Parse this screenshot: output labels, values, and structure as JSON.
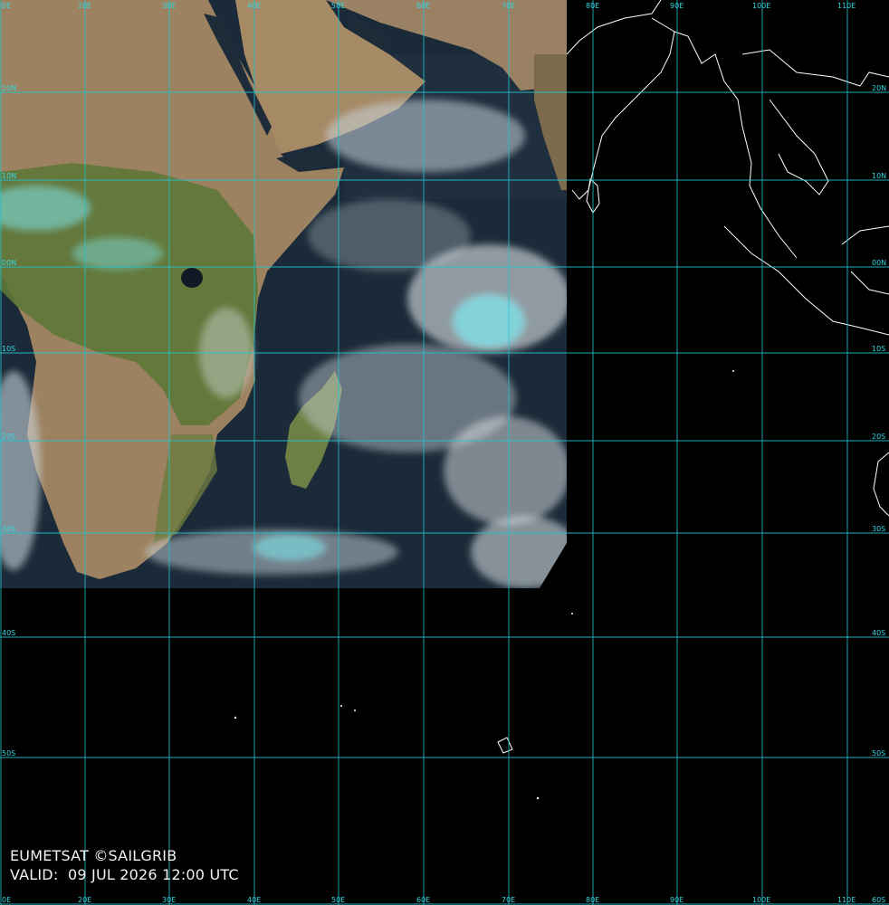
{
  "map": {
    "lon_labels": [
      "0E",
      "20E",
      "30E",
      "40E",
      "50E",
      "60E",
      "70E",
      "80E",
      "90E",
      "100E",
      "110E"
    ],
    "lat_labels": [
      "20N",
      "10N",
      "00N",
      "10S",
      "20S",
      "30S",
      "40S",
      "50S",
      "60S"
    ],
    "credit": "EUMETSAT ©SAILGRIB",
    "valid_label": "VALID:",
    "valid_time": "09 JUL 2026 12:00 UTC",
    "colors": {
      "grid": "#22c5cf",
      "land": "#9c8260",
      "vegetation": "#5c7536",
      "ocean": "#1b2a38",
      "cloud": "#dfe6ea",
      "cloud_cyan": "#7fe6ec",
      "coastline": "#ffffff",
      "background": "#000000"
    }
  }
}
